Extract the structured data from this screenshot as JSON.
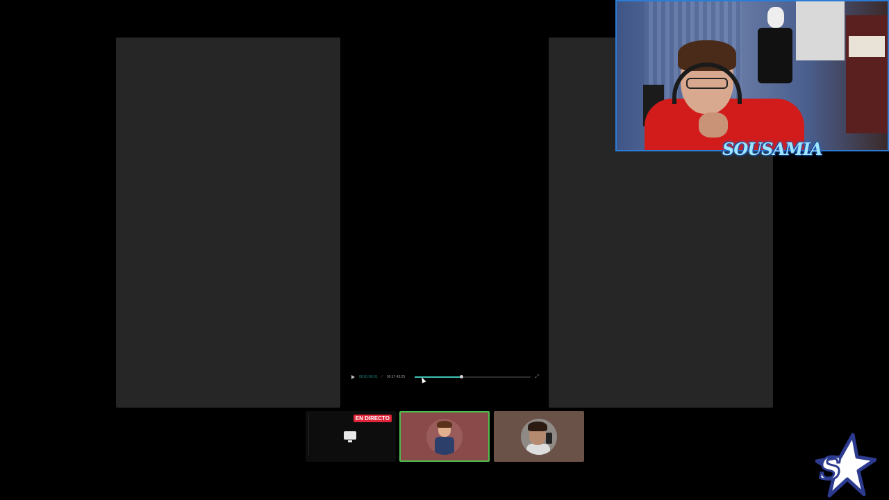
{
  "player": {
    "time_current": "00:01:06:01",
    "time_separator": "/",
    "time_total": "00:17:43:25",
    "progress_fraction": 0.4,
    "icons": {
      "play": "play-icon",
      "expand": "expand-icon"
    }
  },
  "webcam": {
    "overlay_text": "SOUSAMIA"
  },
  "participants": [
    {
      "type": "screenshare",
      "badge": "EN DIRECTO",
      "icon": "screen-share-icon"
    },
    {
      "type": "avatar",
      "image": "cartoon-avatar",
      "active": true,
      "highlight_color": "#4fbf4f"
    },
    {
      "type": "avatar",
      "image": "photo-avatar",
      "active": false
    }
  ],
  "brand": {
    "logo": "star-logo-icon",
    "color": "#2c3a8f"
  },
  "colors": {
    "accent": "#3fc2b8",
    "live": "#e0243a",
    "webcam_border": "#2b7cd6"
  }
}
